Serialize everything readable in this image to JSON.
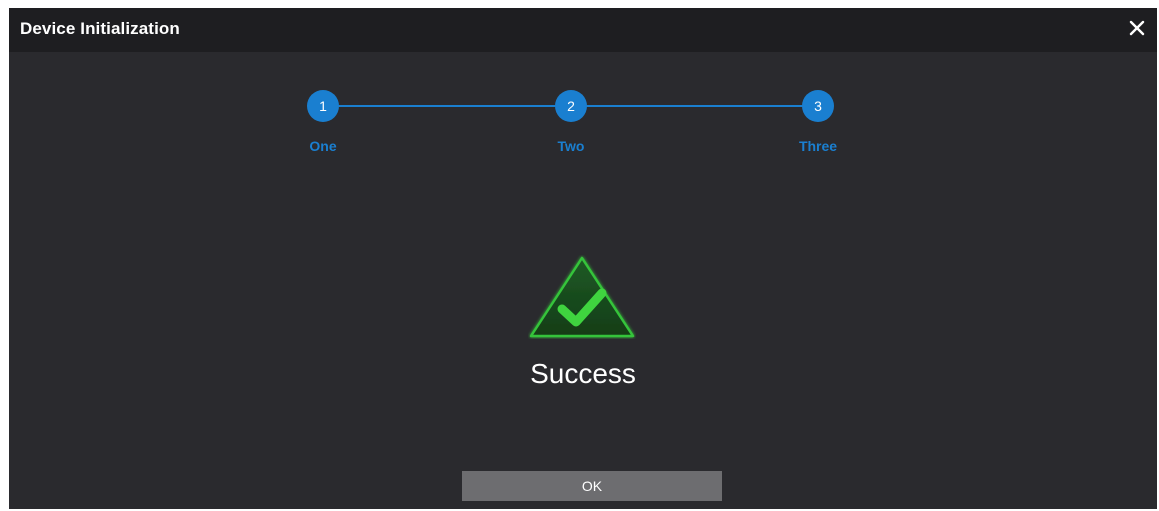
{
  "dialog": {
    "title": "Device Initialization",
    "close_icon": "close-icon"
  },
  "steps": [
    {
      "number": "1",
      "label": "One"
    },
    {
      "number": "2",
      "label": "Two"
    },
    {
      "number": "3",
      "label": "Three"
    }
  ],
  "result": {
    "icon": "success-check-icon",
    "message": "Success"
  },
  "footer": {
    "ok_label": "OK"
  },
  "colors": {
    "accent": "#1a7fd0",
    "success": "#2eb82e",
    "background": "#2a2a2e",
    "titlebar": "#1e1e21",
    "button": "#6d6d70"
  }
}
